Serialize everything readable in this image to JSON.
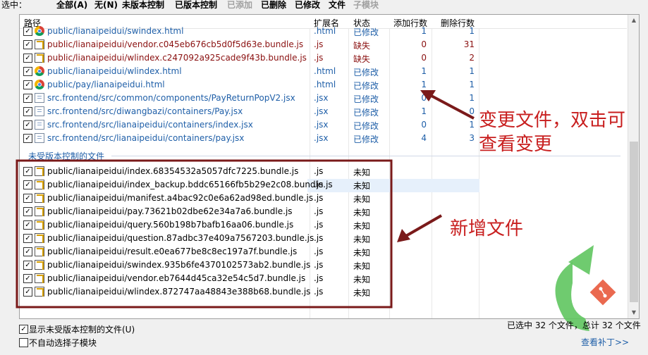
{
  "selection_bar": {
    "label": "选中：",
    "all": "全部(A)",
    "none": "无(N)",
    "unversioned": "未版本控制",
    "versioned": "已版本控制",
    "added": "已添加",
    "deleted": "已删除",
    "modified": "已修改",
    "files": "文件",
    "submodules": "子模块"
  },
  "columns": {
    "path": "路径",
    "extension": "扩展名",
    "status": "状态",
    "lines_added": "添加行数",
    "lines_deleted": "删除行数"
  },
  "versioned_files": [
    {
      "path": "public/lianaipeidui/swindex.html",
      "ext": ".html",
      "status": "已修改",
      "added": "1",
      "deleted": "1",
      "icon": "chrome-icon",
      "color": "blue"
    },
    {
      "path": "public/lianaipeidui/vendor.c045eb676cb5d0f5d63e.bundle.js",
      "ext": ".js",
      "status": "缺失",
      "added": "0",
      "deleted": "31",
      "icon": "js-file-icon",
      "color": "red"
    },
    {
      "path": "public/lianaipeidui/wlindex.c247092a925cade9f43b.bundle.js",
      "ext": ".js",
      "status": "缺失",
      "added": "0",
      "deleted": "2",
      "icon": "js-file-icon",
      "color": "red"
    },
    {
      "path": "public/lianaipeidui/wlindex.html",
      "ext": ".html",
      "status": "已修改",
      "added": "1",
      "deleted": "1",
      "icon": "chrome-icon",
      "color": "blue"
    },
    {
      "path": "public/pay/lianaipeidui.html",
      "ext": ".html",
      "status": "已修改",
      "added": "1",
      "deleted": "1",
      "icon": "chrome-icon",
      "color": "blue"
    },
    {
      "path": "src.frontend/src/common/components/PayReturnPopV2.jsx",
      "ext": ".jsx",
      "status": "已修改",
      "added": "0",
      "deleted": "1",
      "icon": "doc-file-icon",
      "color": "blue"
    },
    {
      "path": "src.frontend/src/diwangbazi/containers/Pay.jsx",
      "ext": ".jsx",
      "status": "已修改",
      "added": "1",
      "deleted": "0",
      "icon": "doc-file-icon",
      "color": "blue"
    },
    {
      "path": "src.frontend/src/lianaipeidui/containers/index.jsx",
      "ext": ".jsx",
      "status": "已修改",
      "added": "0",
      "deleted": "1",
      "icon": "doc-file-icon",
      "color": "blue"
    },
    {
      "path": "src.frontend/src/lianaipeidui/containers/pay.jsx",
      "ext": ".jsx",
      "status": "已修改",
      "added": "4",
      "deleted": "3",
      "icon": "doc-file-icon",
      "color": "blue"
    }
  ],
  "unversioned_group_label": "未受版本控制的文件",
  "unversioned_files": [
    {
      "path": "public/lianaipeidui/index.68354532a5057dfc7225.bundle.js",
      "ext": ".js",
      "status": "未知"
    },
    {
      "path": "public/lianaipeidui/index_backup.bddc65166fb5b29e2c08.bundle.js",
      "ext": ".js",
      "status": "未知"
    },
    {
      "path": "public/lianaipeidui/manifest.a4bac92c0e6a62ad98ed.bundle.js",
      "ext": ".js",
      "status": "未知"
    },
    {
      "path": "public/lianaipeidui/pay.73621b02dbe62e34a7a6.bundle.js",
      "ext": ".js",
      "status": "未知"
    },
    {
      "path": "public/lianaipeidui/query.560b198b7bafb16aa06.bundle.js",
      "ext": ".js",
      "status": "未知"
    },
    {
      "path": "public/lianaipeidui/question.87adbc37e409a7567203.bundle.js",
      "ext": ".js",
      "status": "未知"
    },
    {
      "path": "public/lianaipeidui/result.e0ea677be8c8ec197a7f.bundle.js",
      "ext": ".js",
      "status": "未知"
    },
    {
      "path": "public/lianaipeidui/swindex.935b6fe4370102573ab2.bundle.js",
      "ext": ".js",
      "status": "未知"
    },
    {
      "path": "public/lianaipeidui/vendor.eb7644d45ca32e54c5d7.bundle.js",
      "ext": ".js",
      "status": "未知"
    },
    {
      "path": "public/lianaipeidui/wlindex.872747aa48843e388b68.bundle.js",
      "ext": ".js",
      "status": "未知"
    }
  ],
  "annotations": {
    "changed_line1": "变更文件，双击可",
    "changed_line2": "查看变更",
    "new_files": "新增文件"
  },
  "options": {
    "show_unversioned": "显示未受版本控制的文件(U)",
    "no_auto_select_submodules": "不自动选择子模块"
  },
  "status_text": "已选中 32 个文件，总计 32 个文件",
  "view_patch_link": "查看补丁>>",
  "colors": {
    "annotation_red": "#c81e1e",
    "box_dark_red": "#7a1a1a",
    "link_blue": "#1f5fa8",
    "missing_red": "#8a1010",
    "logo_green": "#5fc55f"
  }
}
